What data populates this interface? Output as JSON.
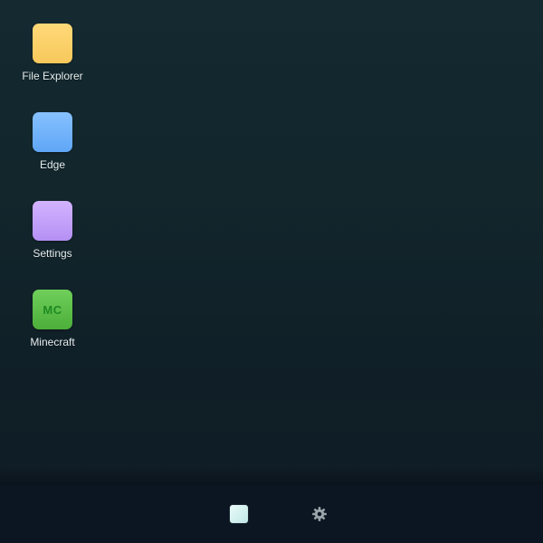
{
  "desktop": {
    "icons": [
      {
        "label": "File Explorer",
        "icon": "folder-icon",
        "color": "#f8c95d"
      },
      {
        "label": "Edge",
        "icon": "edge-icon",
        "color": "#68abf8"
      },
      {
        "label": "Settings",
        "icon": "settings-icon",
        "color": "#bb97f6"
      },
      {
        "label": "Minecraft",
        "icon": "minecraft-icon",
        "color": "#52b640",
        "glyph_text": "MC"
      }
    ]
  },
  "taskbar": {
    "items": [
      {
        "icon": "start-icon",
        "color": "#d6f3f1"
      },
      {
        "icon": "gear-icon",
        "color": "#9aa3aa"
      }
    ]
  },
  "colors": {
    "desktop_background": "#12262c",
    "taskbar_background": "#0c1622",
    "label_text": "#e6eef0"
  }
}
